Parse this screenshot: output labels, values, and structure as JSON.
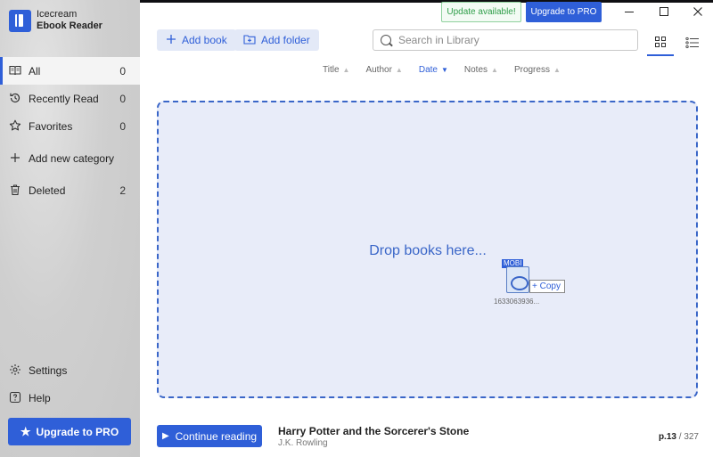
{
  "app": {
    "name_line1": "Icecream",
    "name_line2": "Ebook Reader"
  },
  "top": {
    "update_label": "Update available!",
    "upgrade_label": "Upgrade to PRO"
  },
  "sidebar": {
    "items": [
      {
        "label": "All",
        "count": "0",
        "icon": "book-open-icon"
      },
      {
        "label": "Recently Read",
        "count": "0",
        "icon": "history-icon"
      },
      {
        "label": "Favorites",
        "count": "0",
        "icon": "star-outline-icon"
      },
      {
        "label": "Add new category",
        "count": "",
        "icon": "plus-icon"
      },
      {
        "label": "Deleted",
        "count": "2",
        "icon": "trash-icon"
      }
    ],
    "settings_label": "Settings",
    "help_label": "Help",
    "upgrade_label": "Upgrade to PRO"
  },
  "toolbar": {
    "add_book_label": "Add book",
    "add_folder_label": "Add folder",
    "search_placeholder": "Search in Library"
  },
  "sort": {
    "columns": [
      "Title",
      "Author",
      "Date",
      "Notes",
      "Progress"
    ],
    "active": "Date"
  },
  "drop": {
    "text": "Drop books here...",
    "drag_badge": "MOBI",
    "drag_action": "Copy",
    "drag_filename": "1633063936..."
  },
  "footer": {
    "continue_label": "Continue reading",
    "book_title": "Harry Potter and the Sorcerer's Stone",
    "book_author": "J.K. Rowling",
    "page_current": "p.13",
    "page_total": "327"
  },
  "colors": {
    "accent": "#2f5fd8",
    "update_green": "#2f9e49",
    "drop_bg": "#e8ecf9"
  }
}
